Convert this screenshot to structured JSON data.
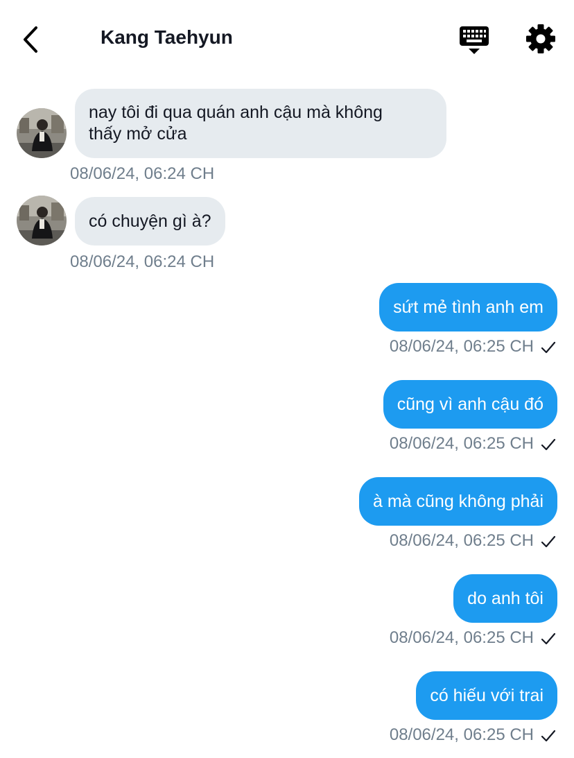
{
  "header": {
    "back_icon": "chevron-left-icon",
    "title": "Kang Taehyun",
    "keyboard_icon": "keyboard-icon",
    "settings_icon": "gear-icon"
  },
  "colors": {
    "incoming_bubble": "#e6ebef",
    "outgoing_bubble": "#1d9bf0",
    "timestamp": "#6f7e8c",
    "text": "#141823"
  },
  "messages": [
    {
      "direction": "incoming",
      "lines": [
        "nay tôi đi qua quán anh cậu mà không",
        "thấy mở cửa"
      ],
      "time": "08/06/24, 06:24 CH"
    },
    {
      "direction": "incoming",
      "text": "có chuyện gì à?",
      "time": "08/06/24, 06:24 CH"
    },
    {
      "direction": "outgoing",
      "text": "sứt mẻ tình anh em",
      "time": "08/06/24, 06:25 CH",
      "status_icon": "check-icon"
    },
    {
      "direction": "outgoing",
      "text": "cũng vì anh cậu đó",
      "time": "08/06/24, 06:25 CH",
      "status_icon": "check-icon"
    },
    {
      "direction": "outgoing",
      "text": "à mà cũng không phải",
      "time": "08/06/24, 06:25 CH",
      "status_icon": "check-icon"
    },
    {
      "direction": "outgoing",
      "text": "do anh tôi",
      "time": "08/06/24, 06:25 CH",
      "status_icon": "check-icon"
    },
    {
      "direction": "outgoing",
      "text": "có hiếu với trai",
      "time": "08/06/24, 06:25 CH",
      "status_icon": "check-icon"
    }
  ]
}
